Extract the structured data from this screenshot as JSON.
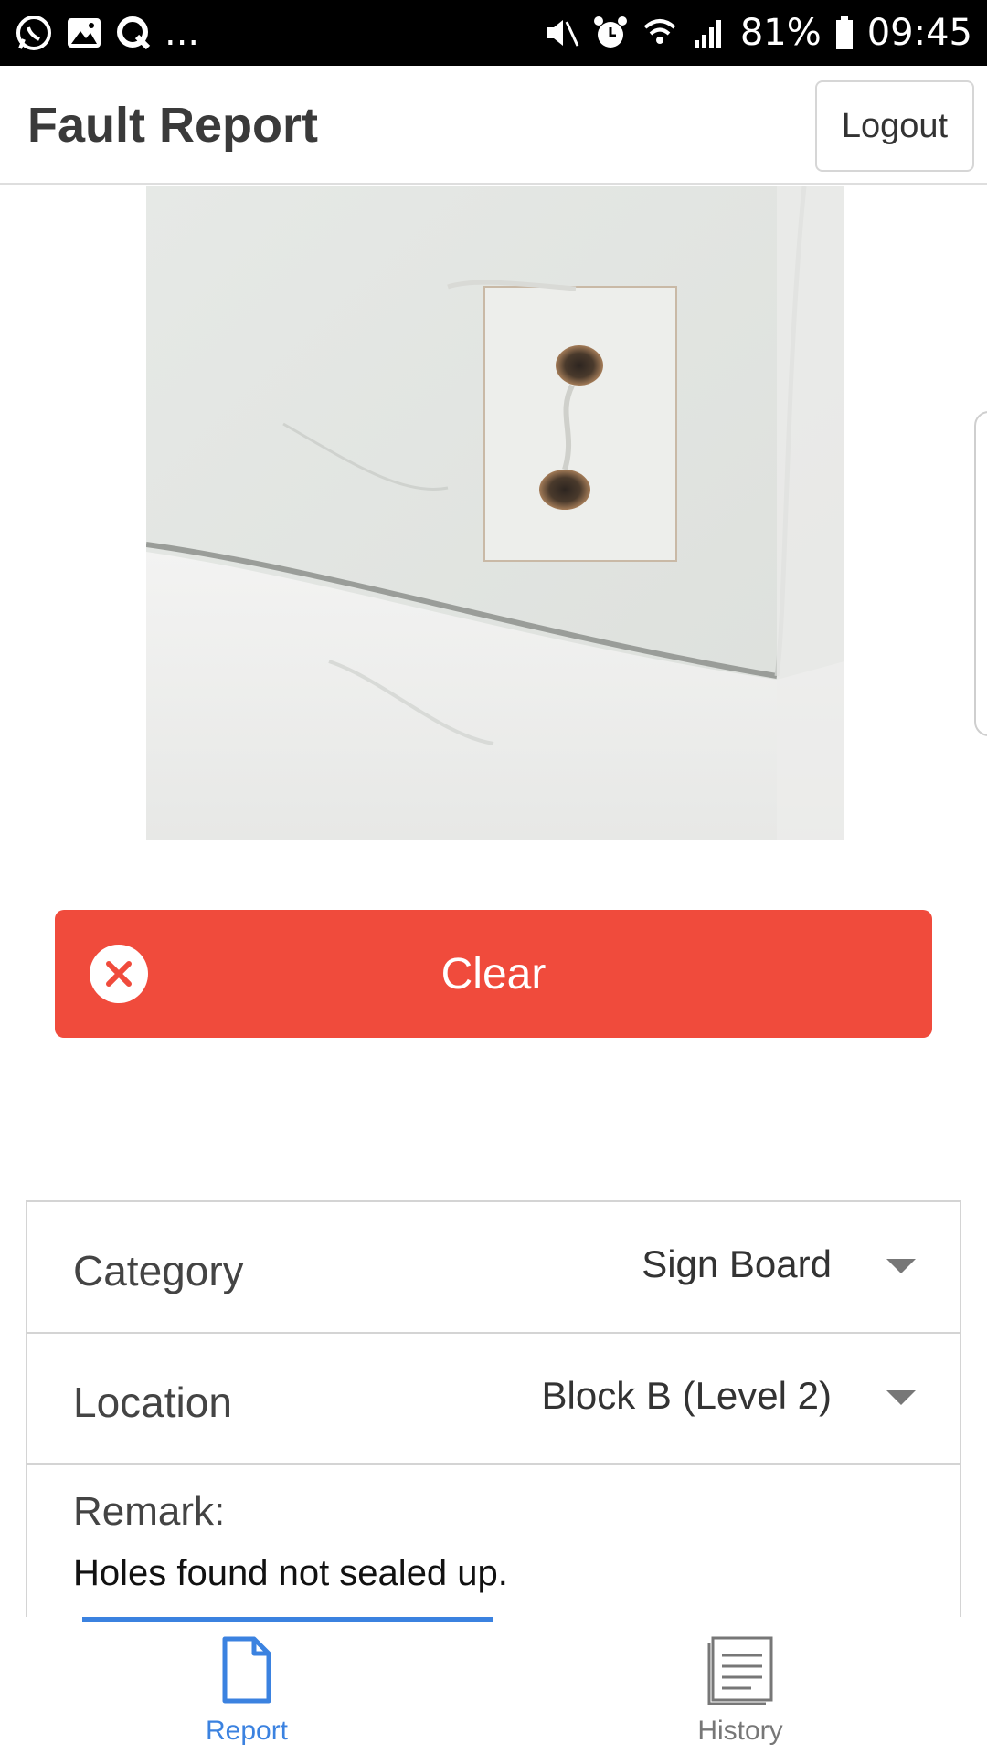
{
  "status_bar": {
    "left_icons": [
      "whatsapp-icon",
      "gallery-icon",
      "q-app-icon"
    ],
    "more": "...",
    "right_icons": [
      "mute-icon",
      "alarm-icon",
      "wifi-icon",
      "signal-icon",
      "battery-icon"
    ],
    "battery": "81%",
    "time": "09:45"
  },
  "header": {
    "title": "Fault Report",
    "logout_label": "Logout"
  },
  "photo": {
    "icon": "wall-photo"
  },
  "clear_button": {
    "label": "Clear",
    "icon": "close-circle-icon",
    "color": "#f04b3c"
  },
  "form": {
    "category": {
      "label": "Category",
      "value": "Sign Board"
    },
    "location": {
      "label": "Location",
      "value": "Block B (Level 2)"
    },
    "remark": {
      "label": "Remark:",
      "value": "Holes found not sealed up."
    }
  },
  "bottom_nav": {
    "tabs": [
      {
        "label": "Report",
        "icon": "document-icon",
        "active": true
      },
      {
        "label": "History",
        "icon": "list-icon",
        "active": false
      }
    ],
    "accent": "#3b82e0"
  }
}
